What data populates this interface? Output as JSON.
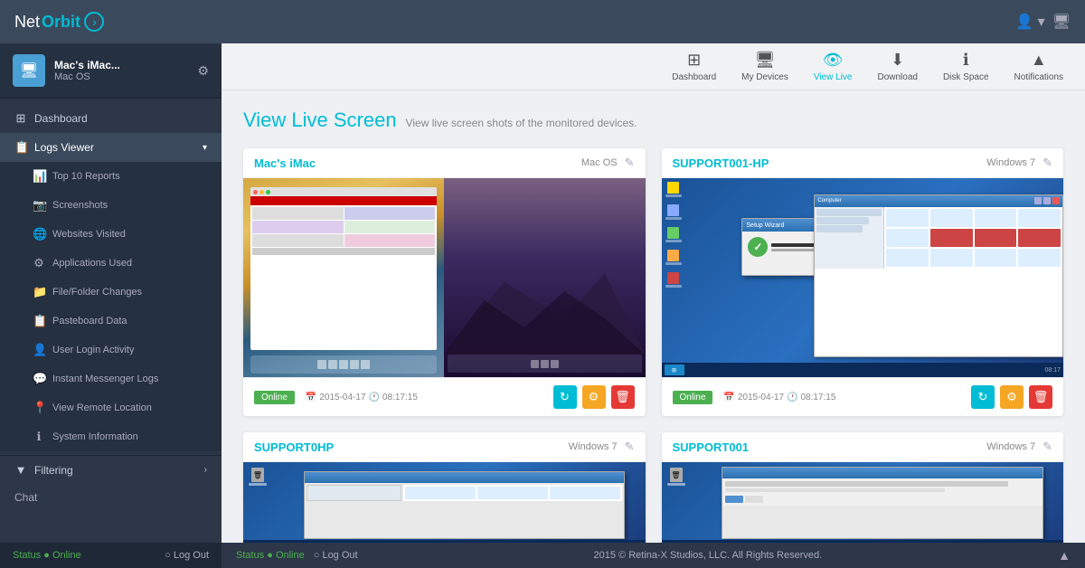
{
  "app": {
    "logo_net": "Net",
    "logo_orbit": "Orbit"
  },
  "topbar": {
    "user_icon": "👤",
    "monitor_icon": "🖥"
  },
  "top_icons": [
    {
      "id": "dashboard",
      "label": "Dashboard",
      "icon": "⊞",
      "active": false
    },
    {
      "id": "my-devices",
      "label": "My Devices",
      "icon": "🖥",
      "active": false
    },
    {
      "id": "view-live",
      "label": "View Live",
      "icon": "👁",
      "active": true
    },
    {
      "id": "download",
      "label": "Download",
      "icon": "⬇",
      "active": false
    },
    {
      "id": "disk-space",
      "label": "Disk Space",
      "icon": "ℹ",
      "active": false
    },
    {
      "id": "notifications",
      "label": "Notifications",
      "icon": "▲",
      "active": false
    }
  ],
  "sidebar": {
    "user_name": "Mac's iMac...",
    "user_os": "Mac OS",
    "user_avatar_icon": "🖥",
    "nav_items": [
      {
        "id": "dashboard",
        "label": "Dashboard",
        "icon": "⊞",
        "has_arrow": false
      },
      {
        "id": "logs-viewer",
        "label": "Logs Viewer",
        "icon": "📋",
        "has_arrow": true,
        "active": true
      }
    ],
    "sub_nav_items": [
      {
        "id": "top10",
        "label": "Top 10 Reports",
        "icon": "📊"
      },
      {
        "id": "screenshots",
        "label": "Screenshots",
        "icon": "📷"
      },
      {
        "id": "websites",
        "label": "Websites Visited",
        "icon": "🌐"
      },
      {
        "id": "applications",
        "label": "Applications Used",
        "icon": "⚙"
      },
      {
        "id": "file-changes",
        "label": "File/Folder Changes",
        "icon": "📁"
      },
      {
        "id": "pasteboard",
        "label": "Pasteboard Data",
        "icon": "📋"
      },
      {
        "id": "user-login",
        "label": "User Login Activity",
        "icon": "👤"
      },
      {
        "id": "im-logs",
        "label": "Instant Messenger Logs",
        "icon": "💬"
      },
      {
        "id": "remote-location",
        "label": "View Remote Location",
        "icon": "📍"
      },
      {
        "id": "system-info",
        "label": "System Information",
        "icon": "ℹ"
      }
    ],
    "filtering_label": "Filtering",
    "status_label": "Status ● Online",
    "logout_label": "○ Log Out",
    "chat_label": "Chat"
  },
  "page": {
    "title": "View Live Screen",
    "subtitle": "View live screen shots of the monitored devices."
  },
  "devices": [
    {
      "id": "macs-imac",
      "name": "Mac's iMac",
      "os": "Mac OS",
      "status": "Online",
      "date": "2015-04-17",
      "time": "08:17:15",
      "type": "mac"
    },
    {
      "id": "support001-hp",
      "name": "SUPPORT001-HP",
      "os": "Windows 7",
      "status": "Online",
      "date": "2015-04-17",
      "time": "08:17:15",
      "type": "windows"
    },
    {
      "id": "support0hp",
      "name": "SUPPORT0HP",
      "os": "Windows 7",
      "status": null,
      "date": null,
      "time": null,
      "type": "windows2"
    },
    {
      "id": "support001",
      "name": "SUPPORT001",
      "os": "Windows 7",
      "status": null,
      "date": null,
      "time": null,
      "type": "windows3"
    }
  ],
  "buttons": {
    "refresh": "↻",
    "settings": "⚙",
    "delete": "🗑"
  },
  "footer": {
    "status": "Status ● Online",
    "copyright": "2015 © Retina-X Studios, LLC. All Rights Reserved.",
    "arrow": "▲"
  }
}
